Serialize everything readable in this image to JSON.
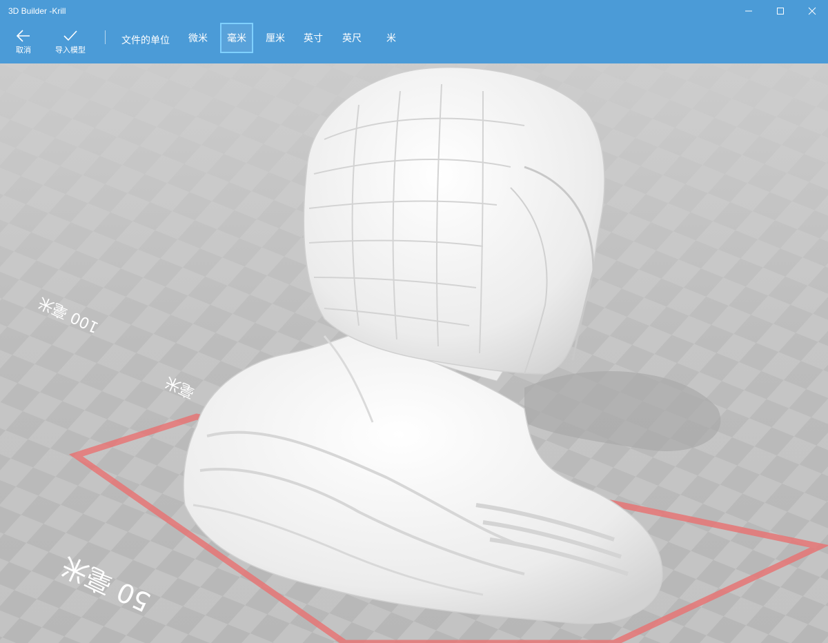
{
  "window": {
    "title": "3D Builder -Krill"
  },
  "toolbar": {
    "cancel": {
      "label": "取消",
      "icon": "back-arrow-icon"
    },
    "import": {
      "label": "导入模型",
      "icon": "checkmark-icon"
    },
    "units_label": "文件的单位",
    "units": [
      {
        "label": "微米",
        "selected": false
      },
      {
        "label": "毫米",
        "selected": true
      },
      {
        "label": "厘米",
        "selected": false
      },
      {
        "label": "英寸",
        "selected": false
      },
      {
        "label": "英尺",
        "selected": false
      },
      {
        "label": "米",
        "selected": false
      }
    ]
  },
  "viewport": {
    "dimension_labels": {
      "far": "100 毫米",
      "mid": "毫米",
      "near": "50 毫米"
    }
  },
  "colors": {
    "accent": "#4b9bd7",
    "selected_border": "#7fd0ff",
    "floor": "#bdbdbd",
    "bounding_box": "#e87070",
    "model": "#f2f2f2"
  }
}
